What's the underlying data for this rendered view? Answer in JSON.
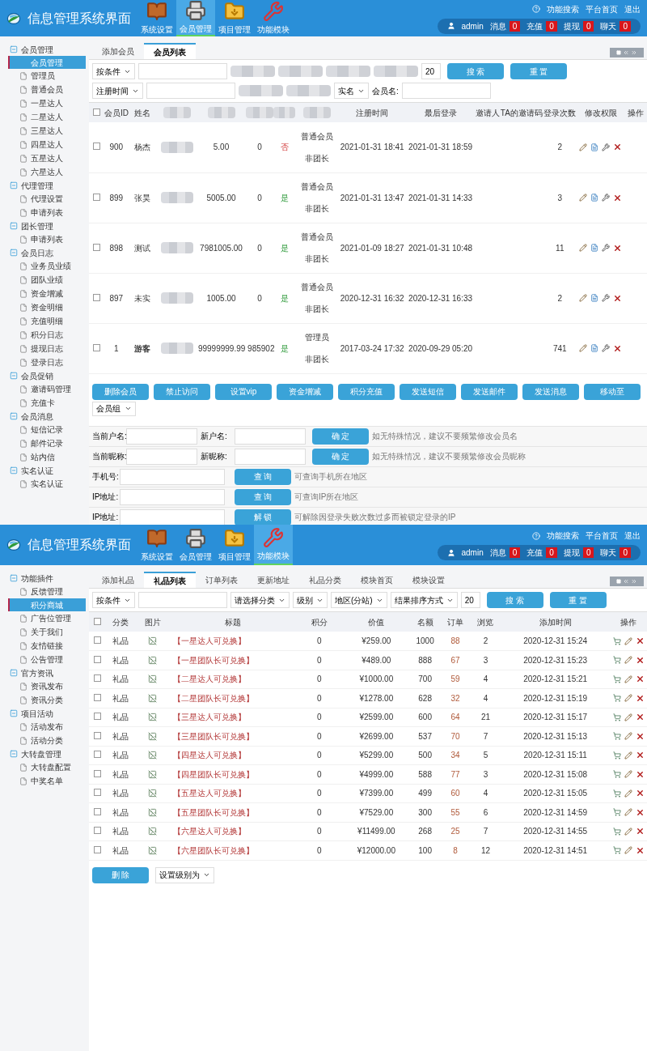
{
  "screens": [
    {
      "kind": "members",
      "header": {
        "title": "信息管理系统界面",
        "nav": [
          {
            "label": "系统设置",
            "kind": "book",
            "selected": false
          },
          {
            "label": "会员管理",
            "kind": "printer",
            "selected": true
          },
          {
            "label": "项目管理",
            "kind": "folder",
            "selected": false
          },
          {
            "label": "功能模块",
            "kind": "tools",
            "selected": false
          }
        ],
        "links": [
          "功能搜索",
          "平台首页",
          "退出"
        ],
        "user": "admin",
        "counters": [
          {
            "label": "消息",
            "value": "0"
          },
          {
            "label": "充值",
            "value": "0"
          },
          {
            "label": "提现",
            "value": "0"
          },
          {
            "label": "聊天",
            "value": "0"
          }
        ]
      },
      "sidebar": [
        {
          "label": "会员管理",
          "children": [
            {
              "label": "会员管理",
              "selected": true
            },
            {
              "label": "管理员",
              "selected": false
            },
            {
              "label": "普通会员",
              "selected": false
            },
            {
              "label": "一星达人",
              "selected": false
            },
            {
              "label": "二星达人",
              "selected": false
            },
            {
              "label": "三星达人",
              "selected": false
            },
            {
              "label": "四星达人",
              "selected": false
            },
            {
              "label": "五星达人",
              "selected": false
            },
            {
              "label": "六星达人",
              "selected": false
            }
          ]
        },
        {
          "label": "代理管理",
          "children": [
            {
              "label": "代理设置",
              "selected": false
            },
            {
              "label": "申请列表",
              "selected": false
            }
          ]
        },
        {
          "label": "团长管理",
          "children": [
            {
              "label": "申请列表",
              "selected": false
            }
          ]
        },
        {
          "label": "会员日志",
          "children": [
            {
              "label": "业务员业绩",
              "selected": false
            },
            {
              "label": "团队业绩",
              "selected": false
            },
            {
              "label": "资金增减",
              "selected": false
            },
            {
              "label": "资金明细",
              "selected": false
            },
            {
              "label": "充值明细",
              "selected": false
            },
            {
              "label": "积分日志",
              "selected": false
            },
            {
              "label": "提现日志",
              "selected": false
            },
            {
              "label": "登录日志",
              "selected": false
            }
          ]
        },
        {
          "label": "会员促销",
          "children": [
            {
              "label": "邀请码管理",
              "selected": false
            },
            {
              "label": "充值卡",
              "selected": false
            }
          ]
        },
        {
          "label": "会员消息",
          "children": [
            {
              "label": "短信记录",
              "selected": false
            },
            {
              "label": "邮件记录",
              "selected": false
            },
            {
              "label": "站内信",
              "selected": false
            }
          ]
        },
        {
          "label": "实名认证",
          "children": [
            {
              "label": "实名认证",
              "selected": false
            }
          ]
        }
      ],
      "tabs": [
        {
          "label": "添加会员",
          "selected": false
        },
        {
          "label": "会员列表",
          "selected": true
        }
      ],
      "filters": [
        {
          "items": [
            {
              "kind": "select",
              "label": "按条件"
            },
            {
              "kind": "input"
            },
            {
              "kind": "redacted"
            },
            {
              "kind": "redacted"
            },
            {
              "kind": "redacted"
            },
            {
              "kind": "redacted"
            },
            {
              "kind": "input",
              "value": "20"
            }
          ],
          "buttons": [
            "搜 索",
            "重 置"
          ]
        },
        {
          "items": [
            {
              "kind": "select",
              "label": "注册时间"
            },
            {
              "kind": "input"
            },
            {
              "kind": "redacted"
            },
            {
              "kind": "redacted"
            },
            {
              "kind": "select",
              "label": "实名"
            },
            {
              "kind": "label",
              "label": "会员名:"
            },
            {
              "kind": "input"
            }
          ]
        }
      ],
      "all_checked": false,
      "columns": [
        {
          "label": "会员ID"
        },
        {
          "label": "姓名"
        },
        {
          "kind": "redacted"
        },
        {
          "kind": "redacted"
        },
        {
          "kind": "redacted"
        },
        {
          "kind": "redacted"
        },
        {
          "kind": "redacted"
        },
        {
          "label": "注册时间"
        },
        {
          "label": "最后登录"
        },
        {
          "label": "邀请人"
        },
        {
          "label": "TA的邀请码"
        },
        {
          "label": "登录次数"
        },
        {
          "label": "修改权限"
        },
        {
          "label": "操作"
        }
      ],
      "rows": [
        {
          "checked": false,
          "id": "900",
          "name": "杨杰",
          "balance": "5.00",
          "points": "0",
          "verified_text": "否",
          "verified": false,
          "role": "普通会员",
          "leader": "非团长",
          "registered": "2021-01-31 18:41",
          "last_login": "2021-01-31 18:59",
          "logins": "2"
        },
        {
          "checked": false,
          "id": "899",
          "name": "张昊",
          "balance": "5005.00",
          "points": "0",
          "verified_text": "是",
          "verified": true,
          "role": "普通会员",
          "leader": "非团长",
          "registered": "2021-01-31 13:47",
          "last_login": "2021-01-31 14:33",
          "logins": "3"
        },
        {
          "checked": false,
          "id": "898",
          "name": "测试",
          "balance": "7981005.00",
          "points": "0",
          "verified_text": "是",
          "verified": true,
          "role": "普通会员",
          "leader": "非团长",
          "registered": "2021-01-09 18:27",
          "last_login": "2021-01-31 10:48",
          "logins": "11"
        },
        {
          "checked": false,
          "id": "897",
          "name": "未实",
          "balance": "1005.00",
          "points": "0",
          "verified_text": "是",
          "verified": true,
          "role": "普通会员",
          "leader": "非团长",
          "registered": "2020-12-31 16:32",
          "last_login": "2020-12-31 16:33",
          "logins": "2"
        },
        {
          "checked": false,
          "id": "1",
          "name": "游客",
          "balance": "99999999.99",
          "points": "985902",
          "verified_text": "是",
          "verified": true,
          "role": "管理员",
          "leader": "非团长",
          "registered": "2017-03-24 17:32",
          "last_login": "2020-09-29 05:20",
          "logins": "741"
        }
      ],
      "actions": [
        "删除会员",
        "禁止访问",
        "设置vip",
        "资金增减",
        "积分充值",
        "发送短信",
        "发送邮件",
        "发送消息",
        "移动至"
      ],
      "group_select": "会员组",
      "forms": [
        {
          "fields": [
            "当前户名:",
            "新户名:"
          ],
          "button": "确 定",
          "hint": "如无特殊情况，建议不要频繁修改会员名"
        },
        {
          "fields": [
            "当前昵称:",
            "新昵称:"
          ],
          "button": "确 定",
          "hint": "如无特殊情况，建议不要频繁修改会员昵称"
        },
        {
          "fields": [
            "手机号:"
          ],
          "button": "查 询",
          "hint": "可查询手机所在地区"
        },
        {
          "fields": [
            "IP地址:"
          ],
          "button": "查 询",
          "hint": "可查询IP所在地区"
        },
        {
          "fields": [
            "IP地址:"
          ],
          "button": "解 锁",
          "hint": "可解除因登录失败次数过多而被锁定登录的IP"
        }
      ]
    },
    {
      "kind": "gifts",
      "header": {
        "title": "信息管理系统界面",
        "nav": [
          {
            "label": "系统设置",
            "kind": "book",
            "selected": false
          },
          {
            "label": "会员管理",
            "kind": "printer",
            "selected": false
          },
          {
            "label": "项目管理",
            "kind": "folder",
            "selected": false
          },
          {
            "label": "功能模块",
            "kind": "tools",
            "selected": true
          }
        ],
        "links": [
          "功能搜索",
          "平台首页",
          "退出"
        ],
        "user": "admin",
        "counters": [
          {
            "label": "消息",
            "value": "0"
          },
          {
            "label": "充值",
            "value": "0"
          },
          {
            "label": "提现",
            "value": "0"
          },
          {
            "label": "聊天",
            "value": "0"
          }
        ]
      },
      "sidebar": [
        {
          "label": "功能插件",
          "children": [
            {
              "label": "反馈管理",
              "selected": false
            },
            {
              "label": "积分商城",
              "selected": true
            },
            {
              "label": "广告位管理",
              "selected": false
            },
            {
              "label": "关于我们",
              "selected": false
            },
            {
              "label": "友情链接",
              "selected": false
            },
            {
              "label": "公告管理",
              "selected": false
            }
          ]
        },
        {
          "label": "官方资讯",
          "children": [
            {
              "label": "资讯发布",
              "selected": false
            },
            {
              "label": "资讯分类",
              "selected": false
            }
          ]
        },
        {
          "label": "项目活动",
          "children": [
            {
              "label": "活动发布",
              "selected": false
            },
            {
              "label": "活动分类",
              "selected": false
            }
          ]
        },
        {
          "label": "大转盘管理",
          "children": [
            {
              "label": "大转盘配置",
              "selected": false
            },
            {
              "label": "中奖名单",
              "selected": false
            }
          ]
        }
      ],
      "tabs": [
        {
          "label": "添加礼品",
          "selected": false
        },
        {
          "label": "礼品列表",
          "selected": true
        },
        {
          "label": "订单列表",
          "selected": false
        },
        {
          "label": "更新地址",
          "selected": false
        },
        {
          "label": "礼品分类",
          "selected": false
        },
        {
          "label": "模块首页",
          "selected": false
        },
        {
          "label": "模块设置",
          "selected": false
        }
      ],
      "filters": [
        {
          "items": [
            {
              "kind": "select",
              "label": "按条件"
            },
            {
              "kind": "input"
            },
            {
              "kind": "select",
              "label": "请选择分类"
            },
            {
              "kind": "select",
              "label": "级别"
            },
            {
              "kind": "select",
              "label": "地区(分站)"
            },
            {
              "kind": "select",
              "label": "结果排序方式"
            },
            {
              "kind": "input",
              "value": "20"
            }
          ],
          "buttons": [
            "搜 索",
            "重 置"
          ]
        }
      ],
      "all_checked": false,
      "columns": [
        {
          "label": "分类"
        },
        {
          "label": "图片"
        },
        {
          "label": "标题"
        },
        {
          "label": "积分"
        },
        {
          "label": "价值"
        },
        {
          "label": "名额"
        },
        {
          "label": "订单"
        },
        {
          "label": "浏览"
        },
        {
          "label": "添加时间"
        },
        {
          "label": "操作"
        }
      ],
      "rows": [
        {
          "checked": false,
          "category": "礼品",
          "title": "【一星达人可兑换】",
          "points": "0",
          "price": "¥259.00",
          "quota": "1000",
          "orders": "88",
          "views": "2",
          "added": "2020-12-31 15:24"
        },
        {
          "checked": false,
          "category": "礼品",
          "title": "【一星团队长可兑换】",
          "points": "0",
          "price": "¥489.00",
          "quota": "888",
          "orders": "67",
          "views": "3",
          "added": "2020-12-31 15:23"
        },
        {
          "checked": false,
          "category": "礼品",
          "title": "【二星达人可兑换】",
          "points": "0",
          "price": "¥1000.00",
          "quota": "700",
          "orders": "59",
          "views": "4",
          "added": "2020-12-31 15:21"
        },
        {
          "checked": false,
          "category": "礼品",
          "title": "【二星团队长可兑换】",
          "points": "0",
          "price": "¥1278.00",
          "quota": "628",
          "orders": "32",
          "views": "4",
          "added": "2020-12-31 15:19"
        },
        {
          "checked": false,
          "category": "礼品",
          "title": "【三星达人可兑换】",
          "points": "0",
          "price": "¥2599.00",
          "quota": "600",
          "orders": "64",
          "views": "21",
          "added": "2020-12-31 15:17"
        },
        {
          "checked": false,
          "category": "礼品",
          "title": "【三星团队长可兑换】",
          "points": "0",
          "price": "¥2699.00",
          "quota": "537",
          "orders": "70",
          "views": "7",
          "added": "2020-12-31 15:13"
        },
        {
          "checked": false,
          "category": "礼品",
          "title": "【四星达人可兑换】",
          "points": "0",
          "price": "¥5299.00",
          "quota": "500",
          "orders": "34",
          "views": "5",
          "added": "2020-12-31 15:11"
        },
        {
          "checked": false,
          "category": "礼品",
          "title": "【四星团队长可兑换】",
          "points": "0",
          "price": "¥4999.00",
          "quota": "588",
          "orders": "77",
          "views": "3",
          "added": "2020-12-31 15:08"
        },
        {
          "checked": false,
          "category": "礼品",
          "title": "【五星达人可兑换】",
          "points": "0",
          "price": "¥7399.00",
          "quota": "499",
          "orders": "60",
          "views": "4",
          "added": "2020-12-31 15:05"
        },
        {
          "checked": false,
          "category": "礼品",
          "title": "【五星团队长可兑换】",
          "points": "0",
          "price": "¥7529.00",
          "quota": "300",
          "orders": "55",
          "views": "6",
          "added": "2020-12-31 14:59"
        },
        {
          "checked": false,
          "category": "礼品",
          "title": "【六星达人可兑换】",
          "points": "0",
          "price": "¥11499.00",
          "quota": "268",
          "orders": "25",
          "views": "7",
          "added": "2020-12-31 14:55"
        },
        {
          "checked": false,
          "category": "礼品",
          "title": "【六星团队长可兑换】",
          "points": "0",
          "price": "¥12000.00",
          "quota": "100",
          "orders": "8",
          "views": "12",
          "added": "2020-12-31 14:51"
        }
      ],
      "bottom_button": "删 除",
      "level_select": "设置级别为"
    }
  ]
}
